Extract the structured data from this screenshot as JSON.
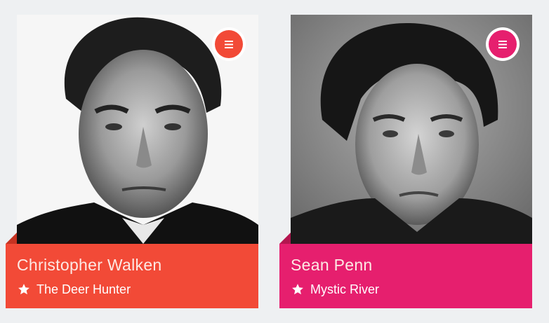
{
  "cards": [
    {
      "name": "Christopher Walken",
      "film": "The Deer Hunter",
      "accent": "#f24a37",
      "accent_dark": "#c63322",
      "photo_bg": "#f4f4f4",
      "menu_icon": "bars-icon",
      "film_icon": "star-icon"
    },
    {
      "name": "Sean Penn",
      "film": "Mystic River",
      "accent": "#e61f6e",
      "accent_dark": "#b4154f",
      "photo_bg": "#8c8c8c",
      "menu_icon": "bars-icon",
      "film_icon": "star-icon"
    }
  ]
}
